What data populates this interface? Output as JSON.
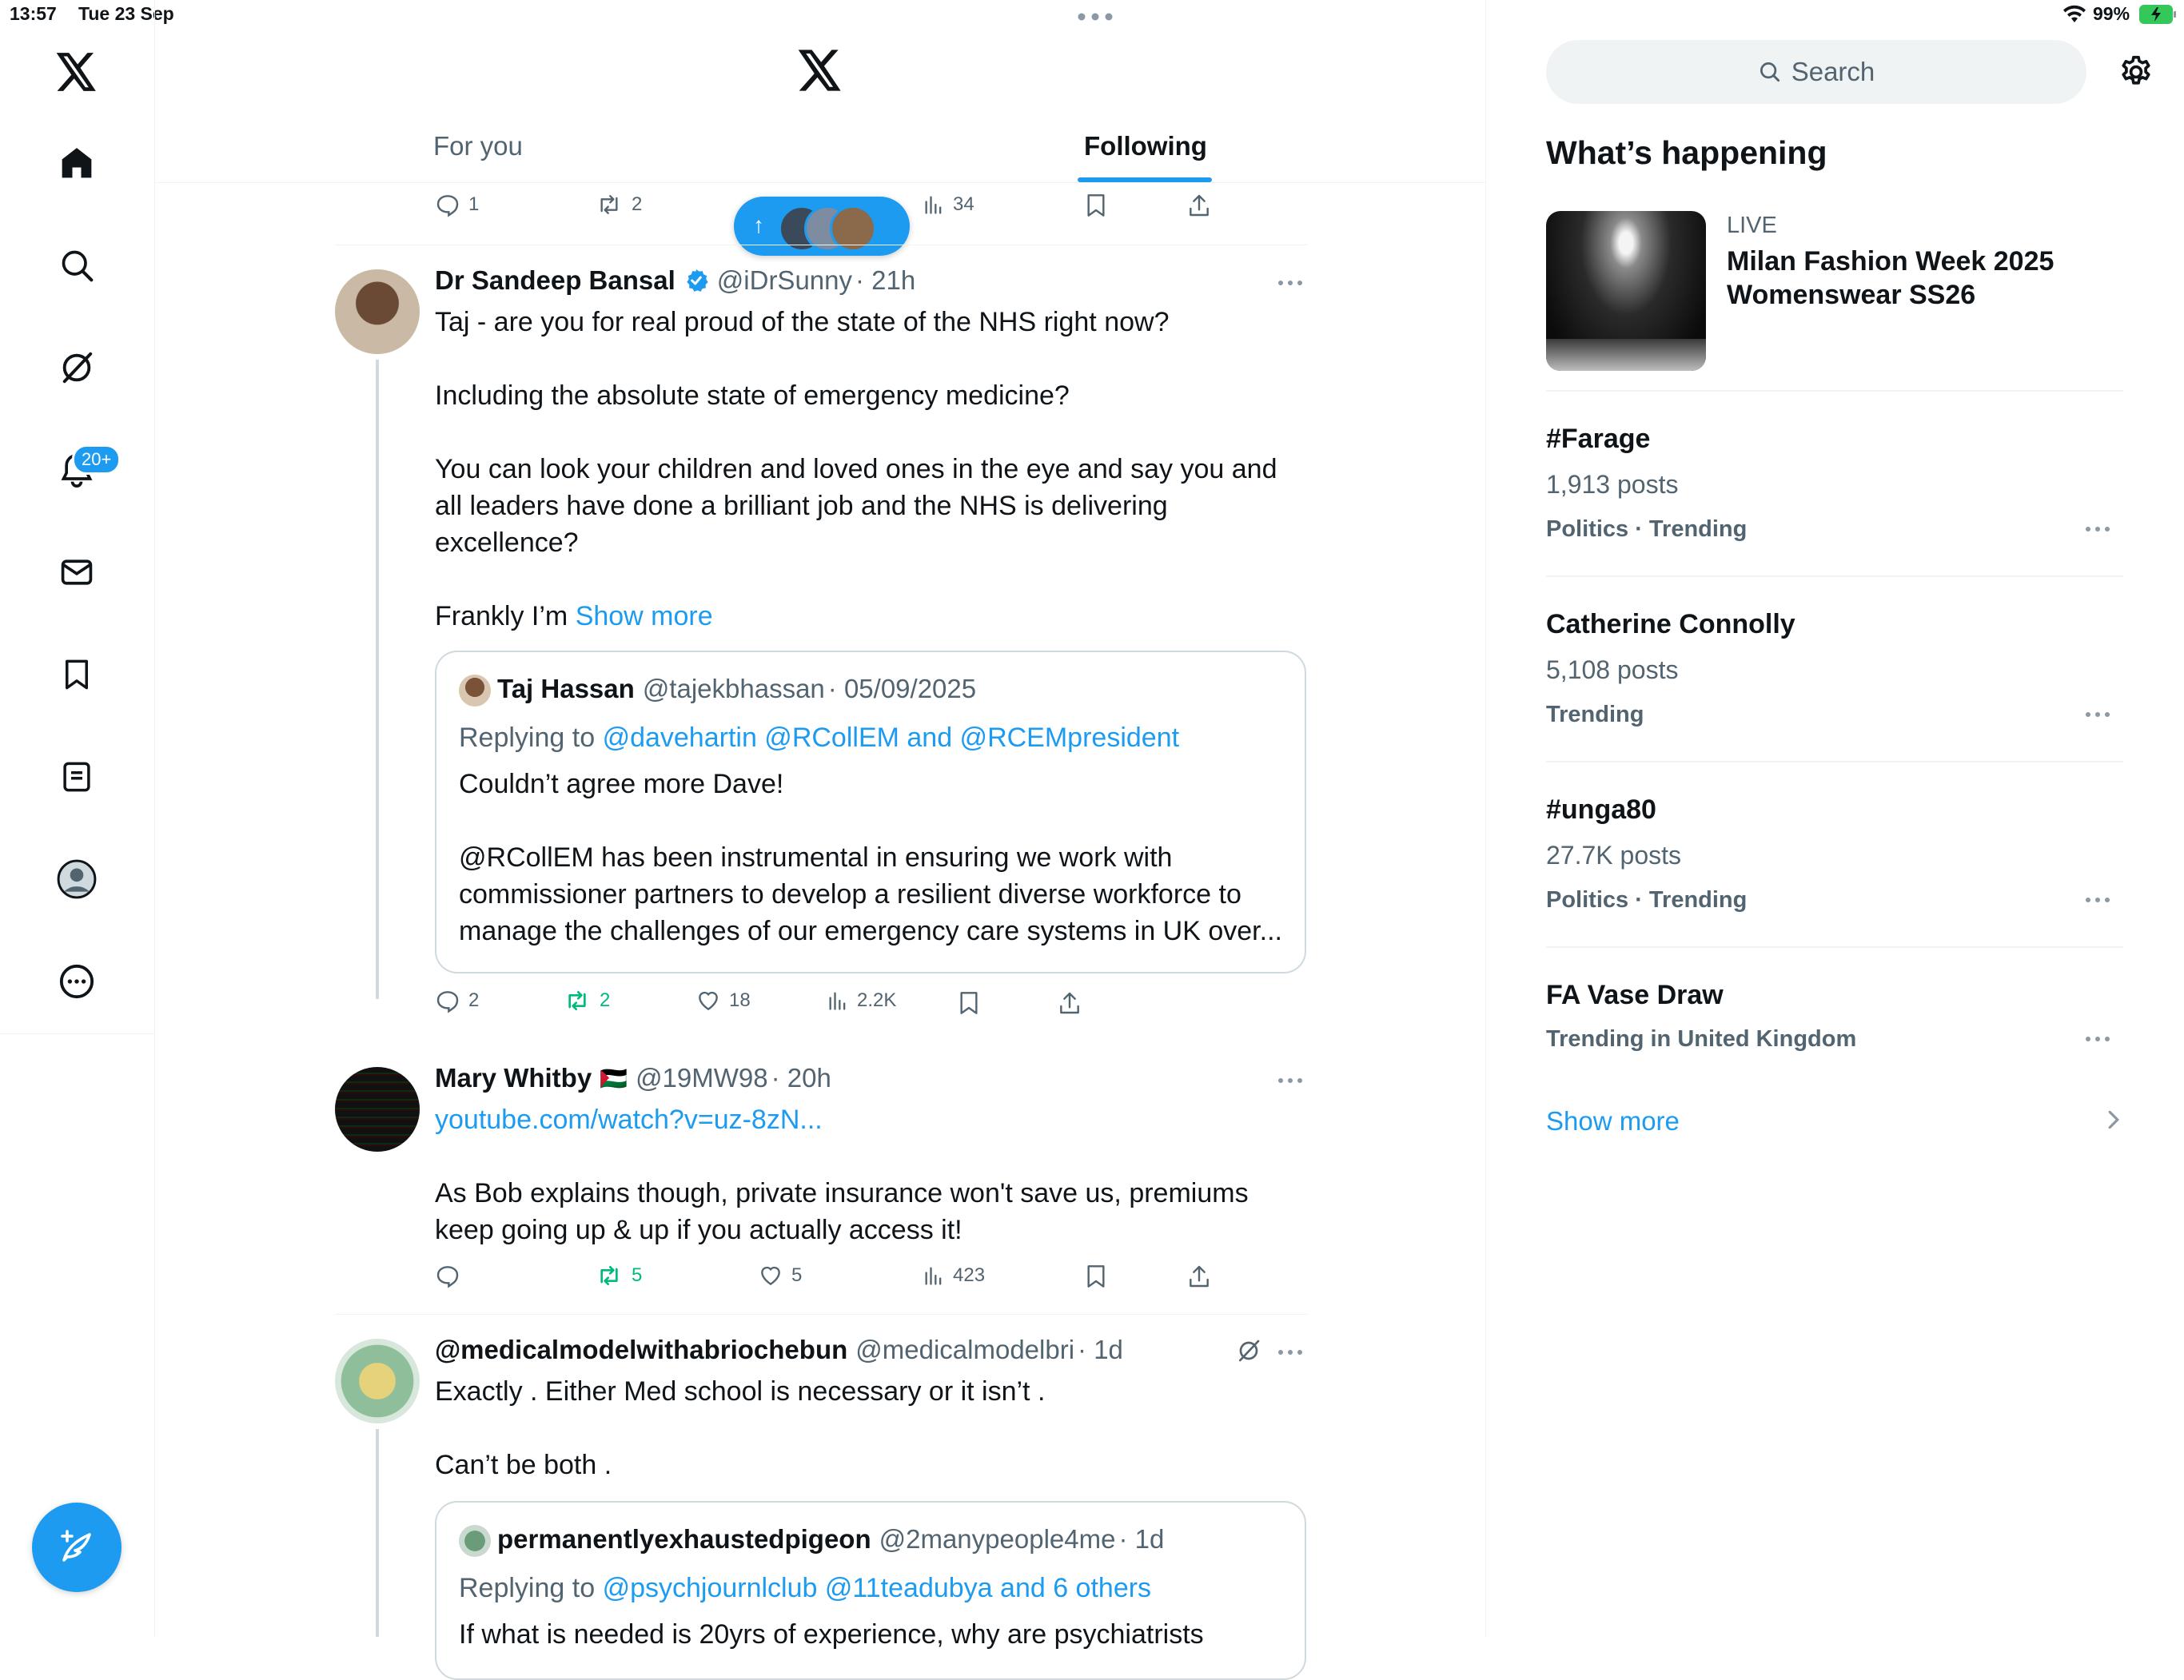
{
  "status_bar": {
    "time": "13:57",
    "date": "Tue 23 Sep",
    "battery": "99%"
  },
  "nav": {
    "notifications_badge": "20+",
    "items": [
      "home",
      "search",
      "grok",
      "notifications",
      "messages",
      "bookmarks",
      "lists",
      "profile",
      "more"
    ]
  },
  "header": {
    "tabs": [
      {
        "label": "For you",
        "active": false
      },
      {
        "label": "Following",
        "active": true
      }
    ]
  },
  "top_actions": {
    "reply": "1",
    "repost": "2",
    "views": "34"
  },
  "new_posts_pill": {
    "arrow": "↑"
  },
  "tweets": [
    {
      "name": "Dr Sandeep Bansal",
      "verified": true,
      "handle": "@iDrSunny",
      "time": "· 21h",
      "lines": [
        "Taj - are you for real proud of the state of the NHS right now?",
        "Including the absolute state of emergency medicine?",
        "You can look your children and loved ones in the eye and say you and",
        "all leaders have done a brilliant job and the NHS is delivering",
        "excellence?",
        "Frankly I’m"
      ],
      "show_more": "Show more",
      "quote": {
        "name": "Taj Hassan",
        "handle": "@tajekbhassan",
        "time": "· 05/09/2025",
        "replying_prefix": "Replying to",
        "replying_to": "@davehartin @RCollEM and @RCEMpresident",
        "lines": [
          "Couldn’t agree more Dave!",
          "@RCollEM has been instrumental in ensuring we work with",
          "commissioner partners to develop a resilient diverse workforce to",
          "manage the challenges of our emergency care systems in UK over..."
        ]
      },
      "actions": {
        "reply": "2",
        "repost": "2",
        "like": "18",
        "views": "2.2K"
      }
    },
    {
      "name": "Mary Whitby",
      "flag": "🇵🇸",
      "handle": "@19MW98",
      "time": "· 20h",
      "link": "youtube.com/watch?v=uz-8zN...",
      "lines": [
        "As Bob explains though,  private insurance won't save us, premiums",
        "keep going up & up if you actually access it!"
      ],
      "actions": {
        "reply": "",
        "repost": "5",
        "like": "5",
        "views": "423"
      }
    },
    {
      "name": "@medicalmodelwithabriochebun",
      "handle": "@medicalmodelbri",
      "time": "· 1d",
      "lines": [
        "Exactly . Either Med school is necessary or it isn’t .",
        "Can’t be both ."
      ],
      "quote": {
        "name": "permanentlyexhaustedpigeon",
        "handle": "@2manypeople4me",
        "time": "· 1d",
        "replying_prefix": "Replying to",
        "replying_to": "@psychjournlclub @11teadubya and 6 others",
        "lines": [
          "If what is needed is 20yrs of experience, why are psychiatrists"
        ]
      }
    }
  ],
  "sidebar": {
    "search_placeholder": "Search",
    "heading": "What’s happening",
    "live": {
      "label": "LIVE",
      "title_line1": "Milan Fashion Week 2025",
      "title_line2": "Womenswear SS26"
    },
    "trends": [
      {
        "title": "#Farage",
        "posts": "1,913 posts",
        "category": "Politics · Trending"
      },
      {
        "title": "Catherine Connolly",
        "posts": "5,108 posts",
        "category": "Trending"
      },
      {
        "title": "#unga80",
        "posts": "27.7K posts",
        "category": "Politics · Trending"
      },
      {
        "title": "FA Vase Draw",
        "posts": "",
        "category": "Trending in United Kingdom"
      }
    ],
    "show_more": "Show more"
  },
  "colors": {
    "accent": "#1d9bf0",
    "repost_green": "#00ba7c",
    "muted": "#536471",
    "divider": "#eff3f4"
  }
}
